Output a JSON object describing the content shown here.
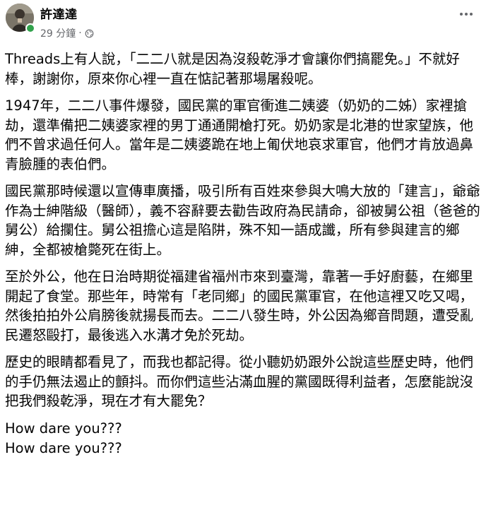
{
  "author": {
    "name": "許達達"
  },
  "meta": {
    "time": "29 分鐘",
    "separator": "·"
  },
  "post": {
    "paragraphs": [
      "Threads上有人說，「二二八就是因為沒殺乾淨才會讓你們搞罷免。」不就好棒，謝謝你，原來你心裡一直在惦記著那場屠殺呢。",
      "1947年，二二八事件爆發，國民黨的軍官衝進二姨婆（奶奶的二姊）家裡搶劫，還準備把二姨婆家裡的男丁通通開槍打死。奶奶家是北港的世家望族，他們不曾求過任何人。當年是二姨婆跪在地上匍伏地哀求軍官，他們才肯放過鼻青臉腫的表伯們。",
      "國民黨那時候還以宣傳車廣播，吸引所有百姓來參與大鳴大放的「建言」，爺爺作為士紳階級（醫師），義不容辭要去勸告政府為民請命，卻被舅公祖（爸爸的舅公）給攔住。舅公祖擔心這是陷阱，殊不知一語成讖，所有參與建言的鄉紳，全都被槍斃死在街上。",
      "至於外公，他在日治時期從福建省福州市來到臺灣，靠著一手好廚藝，在鄉里開起了食堂。那些年，時常有「老同鄉」的國民黨軍官，在他這裡又吃又喝，然後拍拍外公肩膀後就揚長而去。二二八發生時，外公因為鄉音問題，遭受亂民遷怒毆打，最後逃入水溝才免於死劫。",
      "歷史的眼睛都看見了，而我也都記得。從小聽奶奶跟外公說這些歷史時，他們的手仍無法遏止的顫抖。而你們這些沾滿血腥的黨國既得利益者，怎麼能說沒把我們殺乾淨，現在才有大罷免？"
    ],
    "closing": [
      "How dare you???",
      "How dare you???"
    ]
  },
  "icons": {
    "more": "more-horizontal-icon",
    "audience": "globe-icon",
    "avatar": "profile-photo"
  },
  "colors": {
    "text": "#050505",
    "secondary": "#65676b",
    "online": "#31a24c"
  }
}
